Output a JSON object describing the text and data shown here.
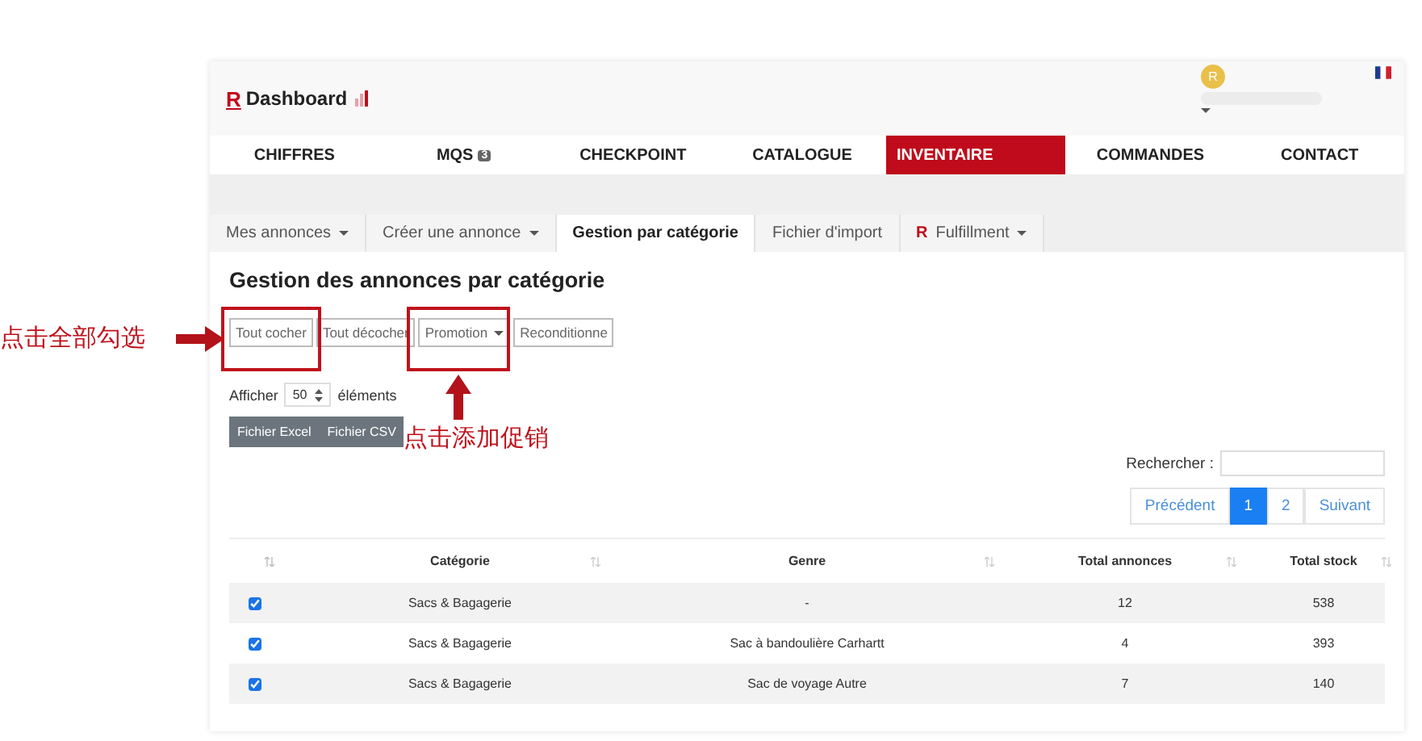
{
  "header": {
    "logo": "R",
    "brand": "Dashboard",
    "avatar_initial": "R"
  },
  "nav": [
    {
      "label": "CHIFFRES",
      "selected": false
    },
    {
      "label": "MQS",
      "badge": "3",
      "selected": false
    },
    {
      "label": "CHECKPOINT",
      "selected": false
    },
    {
      "label": "CATALOGUE",
      "selected": false
    },
    {
      "label": "INVENTAIRE",
      "selected": true
    },
    {
      "label": "COMMANDES",
      "selected": false
    },
    {
      "label": "CONTACT",
      "selected": false
    }
  ],
  "subtabs": [
    {
      "label": "Mes annonces",
      "dropdown": true,
      "selected": false
    },
    {
      "label": "Créer une annonce",
      "dropdown": true,
      "selected": false
    },
    {
      "label": "Gestion par catégorie",
      "dropdown": false,
      "selected": true
    },
    {
      "label": "Fichier d'import",
      "dropdown": false,
      "selected": false
    },
    {
      "label": "Fulfillment",
      "dropdown": true,
      "logo": "R",
      "selected": false
    }
  ],
  "title": "Gestion des annonces par catégorie",
  "actions": [
    {
      "label": "Tout cocher",
      "dropdown": false
    },
    {
      "label": "Tout décocher",
      "dropdown": false
    },
    {
      "label": "Promotion",
      "dropdown": true
    },
    {
      "label": "Reconditionne",
      "dropdown": false
    }
  ],
  "length": {
    "before": "Afficher",
    "value": "50",
    "after": "éléments"
  },
  "exports": [
    "Fichier Excel",
    "Fichier CSV"
  ],
  "search": {
    "label": "Rechercher :"
  },
  "pagination": [
    {
      "label": "Précédent",
      "selected": false
    },
    {
      "label": "1",
      "selected": true
    },
    {
      "label": "2",
      "selected": false
    },
    {
      "label": "Suivant",
      "selected": false
    }
  ],
  "table": {
    "columns": [
      "Catégorie",
      "Genre",
      "Total annonces",
      "Total stock"
    ],
    "rows": [
      {
        "checked": true,
        "cells": [
          "Sacs & Bagagerie",
          "-",
          "12",
          "538"
        ]
      },
      {
        "checked": true,
        "cells": [
          "Sacs & Bagagerie",
          "Sac à bandoulière Carhartt",
          "4",
          "393"
        ]
      },
      {
        "checked": true,
        "cells": [
          "Sacs & Bagagerie",
          "Sac de voyage Autre",
          "7",
          "140"
        ]
      }
    ]
  },
  "annotations": [
    "点击全部勾选",
    "点击添加促销"
  ]
}
